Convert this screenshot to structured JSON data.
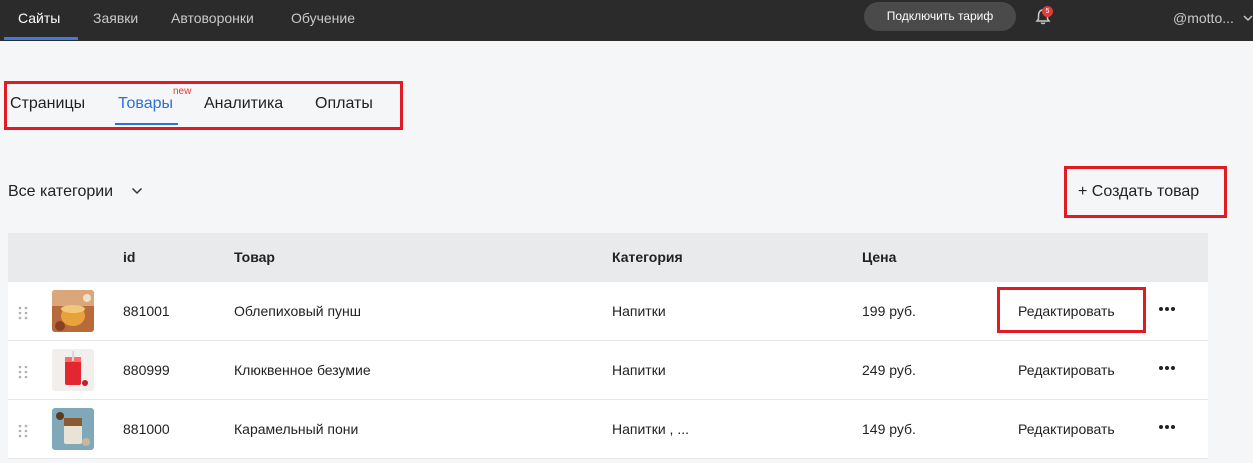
{
  "topnav": {
    "items": [
      {
        "label": "Сайты",
        "active": true
      },
      {
        "label": "Заявки"
      },
      {
        "label": "Автоворонки"
      },
      {
        "label": "Обучение"
      }
    ],
    "tariff_button": "Подключить тариф",
    "notifications_count": "5",
    "user": "@motto..."
  },
  "tabs": {
    "items": [
      {
        "label": "Страницы"
      },
      {
        "label": "Товары",
        "active": true
      },
      {
        "label": "Аналитика"
      },
      {
        "label": "Оплаты"
      }
    ],
    "new_badge": "new"
  },
  "filter": {
    "label": "Все категории"
  },
  "create_button": "+ Создать товар",
  "table": {
    "columns": {
      "id": "id",
      "product": "Товар",
      "category": "Категория",
      "price": "Цена"
    },
    "rows": [
      {
        "id": "881001",
        "name": "Облепиховый пунш",
        "category": "Напитки",
        "price": "199 руб.",
        "edit": "Редактировать"
      },
      {
        "id": "880999",
        "name": "Клюквенное безумие",
        "category": "Напитки",
        "price": "249 руб.",
        "edit": "Редактировать"
      },
      {
        "id": "881000",
        "name": "Карамельный пони",
        "category": "Напитки , ...",
        "price": "149 руб.",
        "edit": "Редактировать"
      }
    ]
  },
  "colors": {
    "accent": "#2f6fd6",
    "highlight": "#e01b24",
    "topbar": "#2b2b2b"
  }
}
